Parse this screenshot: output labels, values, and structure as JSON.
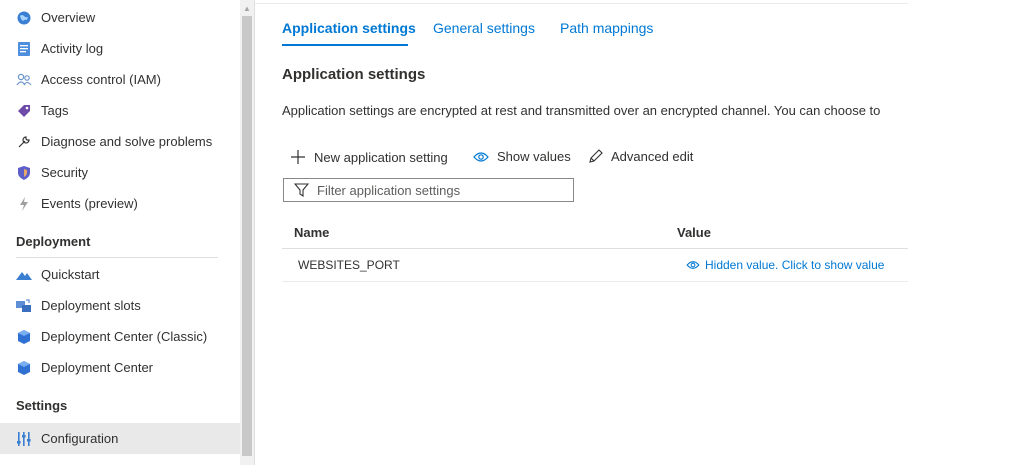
{
  "sidebar": {
    "items_top": [
      {
        "label": "Overview",
        "icon": "globe-icon"
      },
      {
        "label": "Activity log",
        "icon": "log-icon"
      },
      {
        "label": "Access control (IAM)",
        "icon": "people-icon"
      },
      {
        "label": "Tags",
        "icon": "tag-icon"
      },
      {
        "label": "Diagnose and solve problems",
        "icon": "wrench-icon"
      },
      {
        "label": "Security",
        "icon": "shield-icon"
      },
      {
        "label": "Events (preview)",
        "icon": "lightning-icon"
      }
    ],
    "deployment_header": "Deployment",
    "deployment_items": [
      {
        "label": "Quickstart",
        "icon": "cloud-icon"
      },
      {
        "label": "Deployment slots",
        "icon": "slots-icon"
      },
      {
        "label": "Deployment Center (Classic)",
        "icon": "cube-icon"
      },
      {
        "label": "Deployment Center",
        "icon": "cube-icon"
      }
    ],
    "settings_header": "Settings",
    "settings_items": [
      {
        "label": "Configuration",
        "icon": "sliders-icon",
        "selected": true
      }
    ]
  },
  "tabs": [
    {
      "label": "Application settings",
      "active": true
    },
    {
      "label": "General settings",
      "active": false
    },
    {
      "label": "Path mappings",
      "active": false
    }
  ],
  "main": {
    "title": "Application settings",
    "description": "Application settings are encrypted at rest and transmitted over an encrypted channel. You can choose to",
    "toolbar": {
      "new_label": "New application setting",
      "show_label": "Show values",
      "edit_label": "Advanced edit"
    },
    "filter_placeholder": "Filter application settings",
    "table": {
      "headers": [
        "Name",
        "Value"
      ],
      "rows": [
        {
          "name": "WEBSITES_PORT",
          "value": "Hidden value. Click to show value"
        }
      ]
    }
  },
  "colors": {
    "accent": "#0078d4",
    "selected_bg": "#e9e9e9",
    "text": "#323130"
  }
}
